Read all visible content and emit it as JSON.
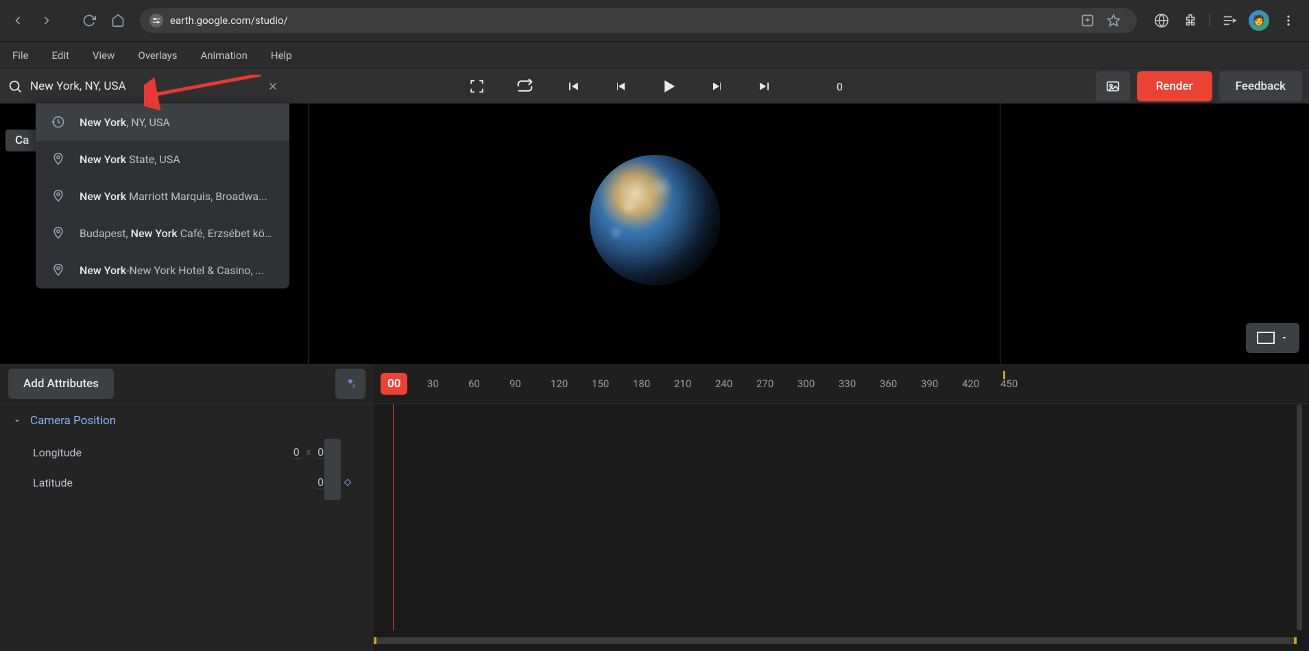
{
  "browser": {
    "url": "earth.google.com/studio/"
  },
  "menubar": [
    "File",
    "Edit",
    "View",
    "Overlays",
    "Animation",
    "Help"
  ],
  "search": {
    "value": "New York, NY, USA"
  },
  "dropdown": [
    {
      "type": "history",
      "bold": "New York",
      "rest": ", NY, USA"
    },
    {
      "type": "place",
      "bold": "New York",
      "rest": " State, USA"
    },
    {
      "type": "place",
      "bold": "New York",
      "rest": " Marriott Marquis, Broadwa..."
    },
    {
      "type": "place",
      "pre": "Budapest, ",
      "bold": "New York",
      "rest": " Café, Erzsébet kör..."
    },
    {
      "type": "place",
      "bold": "New York",
      "rest": "-New York Hotel & Casino, ..."
    }
  ],
  "playback": {
    "frame": "0"
  },
  "buttons": {
    "render": "Render",
    "feedback": "Feedback",
    "add_attributes": "Add Attributes",
    "camera_chip": "Ca"
  },
  "timeline": {
    "ticks": [
      "00",
      "30",
      "60",
      "90",
      "120",
      "150",
      "180",
      "210",
      "240",
      "270",
      "300",
      "330",
      "360",
      "390",
      "420",
      "450"
    ],
    "section": "Camera Position",
    "attributes": {
      "longitude": {
        "label": "Longitude",
        "v1": "0",
        "v2": "0"
      },
      "latitude": {
        "label": "Latitude",
        "v1": "0"
      }
    }
  }
}
